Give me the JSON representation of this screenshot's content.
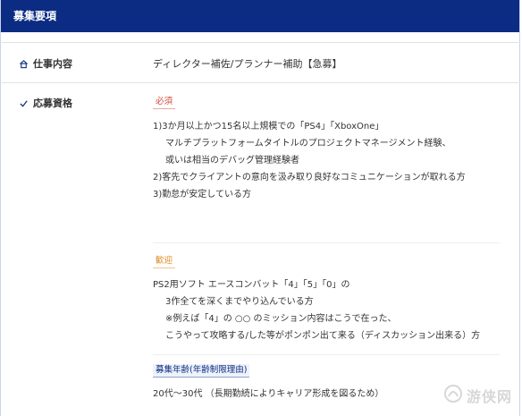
{
  "header": {
    "title": "募集要項"
  },
  "job": {
    "label": "仕事内容",
    "value": "ディレクター補佐/プランナー補助【急募】"
  },
  "qualifications": {
    "label": "応募資格",
    "required": {
      "tag": "必須",
      "lines": [
        "1)3か月以上かつ15名以上規模での「PS4」「XboxOne」",
        "マルチプラットフォームタイトルのプロジェクトマネージメント経験、",
        "或いは相当のデバッグ管理経験者",
        "2)客先でクライアントの意向を汲み取り良好なコミュニケーションが取れる方",
        "3)勤怠が安定している方"
      ]
    },
    "welcome": {
      "tag": "歓迎",
      "lines": [
        "PS2用ソフト エースコンバット「4」「5」「0」の",
        "3作全てを深くまでやり込んでいる方",
        "※例えば「4」の ○○ のミッション内容はこうで在った、",
        "こうやって攻略する/した等がポンポン出て来る（ディスカッション出来る）方"
      ]
    },
    "age": {
      "tag": "募集年齢(年齢制限理由)",
      "value": "20代〜30代 （長期勤続によりキャリア形成を図るため）"
    }
  },
  "watermark": {
    "text": "游侠网"
  },
  "colors": {
    "header_bg": "#0b2c82",
    "required": "#d14b3a",
    "welcome": "#e08a1e"
  },
  "icons": {
    "job": "house-icon",
    "qualifications": "check-icon"
  }
}
